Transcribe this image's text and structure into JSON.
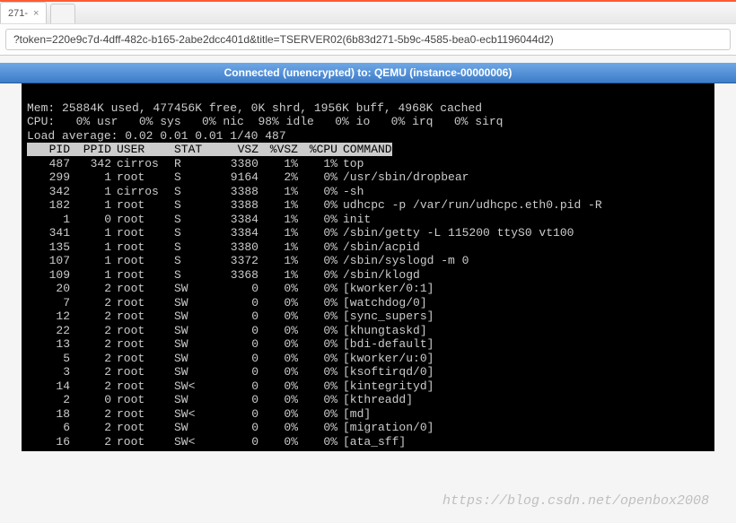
{
  "browser": {
    "tab_label": "271-",
    "url": "?token=220e9c7d-4dff-482c-b165-2abe2dcc401d&title=TSERVER02(6b83d271-5b9c-4585-bea0-ecb1196044d2)"
  },
  "banner": {
    "text": "Connected (unencrypted) to: QEMU (instance-00000006)"
  },
  "terminal": {
    "mem_line": "Mem: 25884K used, 477456K free, 0K shrd, 1956K buff, 4968K cached",
    "cpu_line": "CPU:   0% usr   0% sys   0% nic  98% idle   0% io   0% irq   0% sirq",
    "load_line": "Load average: 0.02 0.01 0.01 1/40 487",
    "header": {
      "PID": "PID",
      "PPID": "PPID",
      "USER": "USER",
      "STAT": "STAT",
      "VSZ": "VSZ",
      "PVSZ": "%VSZ",
      "PCPU": "%CPU",
      "COMMAND": "COMMAND"
    },
    "processes": [
      {
        "pid": "487",
        "ppid": "342",
        "user": "cirros",
        "stat": "R",
        "vsz": "3380",
        "pvsz": "1%",
        "pcpu": "1%",
        "cmd": "top"
      },
      {
        "pid": "299",
        "ppid": "1",
        "user": "root",
        "stat": "S",
        "vsz": "9164",
        "pvsz": "2%",
        "pcpu": "0%",
        "cmd": "/usr/sbin/dropbear"
      },
      {
        "pid": "342",
        "ppid": "1",
        "user": "cirros",
        "stat": "S",
        "vsz": "3388",
        "pvsz": "1%",
        "pcpu": "0%",
        "cmd": "-sh"
      },
      {
        "pid": "182",
        "ppid": "1",
        "user": "root",
        "stat": "S",
        "vsz": "3388",
        "pvsz": "1%",
        "pcpu": "0%",
        "cmd": "udhcpc -p /var/run/udhcpc.eth0.pid -R"
      },
      {
        "pid": "1",
        "ppid": "0",
        "user": "root",
        "stat": "S",
        "vsz": "3384",
        "pvsz": "1%",
        "pcpu": "0%",
        "cmd": "init"
      },
      {
        "pid": "341",
        "ppid": "1",
        "user": "root",
        "stat": "S",
        "vsz": "3384",
        "pvsz": "1%",
        "pcpu": "0%",
        "cmd": "/sbin/getty -L 115200 ttyS0 vt100"
      },
      {
        "pid": "135",
        "ppid": "1",
        "user": "root",
        "stat": "S",
        "vsz": "3380",
        "pvsz": "1%",
        "pcpu": "0%",
        "cmd": "/sbin/acpid"
      },
      {
        "pid": "107",
        "ppid": "1",
        "user": "root",
        "stat": "S",
        "vsz": "3372",
        "pvsz": "1%",
        "pcpu": "0%",
        "cmd": "/sbin/syslogd -m 0"
      },
      {
        "pid": "109",
        "ppid": "1",
        "user": "root",
        "stat": "S",
        "vsz": "3368",
        "pvsz": "1%",
        "pcpu": "0%",
        "cmd": "/sbin/klogd"
      },
      {
        "pid": "20",
        "ppid": "2",
        "user": "root",
        "stat": "SW",
        "vsz": "0",
        "pvsz": "0%",
        "pcpu": "0%",
        "cmd": "[kworker/0:1]"
      },
      {
        "pid": "7",
        "ppid": "2",
        "user": "root",
        "stat": "SW",
        "vsz": "0",
        "pvsz": "0%",
        "pcpu": "0%",
        "cmd": "[watchdog/0]"
      },
      {
        "pid": "12",
        "ppid": "2",
        "user": "root",
        "stat": "SW",
        "vsz": "0",
        "pvsz": "0%",
        "pcpu": "0%",
        "cmd": "[sync_supers]"
      },
      {
        "pid": "22",
        "ppid": "2",
        "user": "root",
        "stat": "SW",
        "vsz": "0",
        "pvsz": "0%",
        "pcpu": "0%",
        "cmd": "[khungtaskd]"
      },
      {
        "pid": "13",
        "ppid": "2",
        "user": "root",
        "stat": "SW",
        "vsz": "0",
        "pvsz": "0%",
        "pcpu": "0%",
        "cmd": "[bdi-default]"
      },
      {
        "pid": "5",
        "ppid": "2",
        "user": "root",
        "stat": "SW",
        "vsz": "0",
        "pvsz": "0%",
        "pcpu": "0%",
        "cmd": "[kworker/u:0]"
      },
      {
        "pid": "3",
        "ppid": "2",
        "user": "root",
        "stat": "SW",
        "vsz": "0",
        "pvsz": "0%",
        "pcpu": "0%",
        "cmd": "[ksoftirqd/0]"
      },
      {
        "pid": "14",
        "ppid": "2",
        "user": "root",
        "stat": "SW<",
        "vsz": "0",
        "pvsz": "0%",
        "pcpu": "0%",
        "cmd": "[kintegrityd]"
      },
      {
        "pid": "2",
        "ppid": "0",
        "user": "root",
        "stat": "SW",
        "vsz": "0",
        "pvsz": "0%",
        "pcpu": "0%",
        "cmd": "[kthreadd]"
      },
      {
        "pid": "18",
        "ppid": "2",
        "user": "root",
        "stat": "SW<",
        "vsz": "0",
        "pvsz": "0%",
        "pcpu": "0%",
        "cmd": "[md]"
      },
      {
        "pid": "6",
        "ppid": "2",
        "user": "root",
        "stat": "SW",
        "vsz": "0",
        "pvsz": "0%",
        "pcpu": "0%",
        "cmd": "[migration/0]"
      },
      {
        "pid": "16",
        "ppid": "2",
        "user": "root",
        "stat": "SW<",
        "vsz": "0",
        "pvsz": "0%",
        "pcpu": "0%",
        "cmd": "[ata_sff]"
      }
    ]
  },
  "watermark": "https://blog.csdn.net/openbox2008"
}
